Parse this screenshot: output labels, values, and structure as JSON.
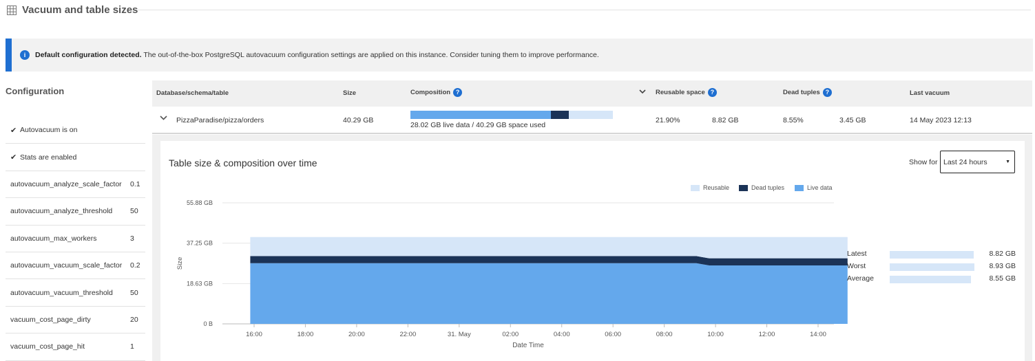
{
  "section": {
    "title": "Vacuum and table sizes",
    "icon": "table-grid-icon"
  },
  "banner": {
    "icon": "info-icon",
    "icon_glyph": "i",
    "bold": "Default configuration detected.",
    "text": " The out-of-the-box PostgreSQL autovacuum configuration settings are applied on this instance. Consider tuning them to improve performance.",
    "accent_color": "#1f6fd1"
  },
  "config": {
    "heading": "Configuration",
    "checks": [
      {
        "label": "Autovacuum is on"
      },
      {
        "label": "Stats are enabled"
      }
    ],
    "settings": [
      {
        "name": "autovacuum_analyze_scale_factor",
        "value": "0.1"
      },
      {
        "name": "autovacuum_analyze_threshold",
        "value": "50"
      },
      {
        "name": "autovacuum_max_workers",
        "value": "3"
      },
      {
        "name": "autovacuum_vacuum_scale_factor",
        "value": "0.2"
      },
      {
        "name": "autovacuum_vacuum_threshold",
        "value": "50"
      },
      {
        "name": "vacuum_cost_page_dirty",
        "value": "20"
      },
      {
        "name": "vacuum_cost_page_hit",
        "value": "1"
      }
    ]
  },
  "table": {
    "headers": {
      "name": "Database/schema/table",
      "size": "Size",
      "composition": "Composition",
      "reusable": "Reusable space",
      "dead": "Dead tuples",
      "last_vacuum": "Last vacuum"
    },
    "row": {
      "name": "PizzaParadise/pizza/orders",
      "size": "40.29 GB",
      "live_fraction": 0.695,
      "dead_fraction": 0.086,
      "composition_label": "28.02 GB live data / 40.29 GB space used",
      "reusable_pct": "21.90%",
      "reusable_size": "8.82 GB",
      "dead_pct": "8.55%",
      "dead_size": "3.45 GB",
      "last_vacuum": "14 May 2023 12:13"
    }
  },
  "chart_panel": {
    "title": "Table size & composition over time",
    "show_for_label": "Show for",
    "range_value": "Last 24 hours"
  },
  "chart_data": {
    "type": "area",
    "stacked": true,
    "title": "Table size & composition over time",
    "xlabel": "Date Time",
    "ylabel": "Size",
    "y_ticks": [
      "0 B",
      "18.63 GB",
      "37.25 GB",
      "55.88 GB"
    ],
    "y_tick_values": [
      0,
      18.63,
      37.25,
      55.88
    ],
    "ylim": [
      0,
      55.88
    ],
    "x_ticks": [
      "16:00",
      "18:00",
      "20:00",
      "22:00",
      "31. May",
      "02:00",
      "04:00",
      "06:00",
      "08:00",
      "10:00",
      "12:00",
      "14:00"
    ],
    "x_tick_hours": [
      16,
      18,
      20,
      22,
      24,
      26,
      28,
      30,
      32,
      34,
      36,
      38
    ],
    "x": [
      15.85,
      18,
      20,
      22,
      24,
      26,
      28,
      30,
      32,
      33.25,
      33.75,
      36,
      39.15
    ],
    "legend_placement": "top-right",
    "series": [
      {
        "name": "Live data",
        "color": "#64a8ec",
        "values": [
          28.0,
          28.0,
          28.0,
          28.0,
          28.0,
          28.0,
          28.0,
          28.0,
          28.0,
          28.0,
          27.0,
          27.0,
          27.0
        ]
      },
      {
        "name": "Dead tuples",
        "color": "#1b3357",
        "values": [
          3.3,
          3.3,
          3.3,
          3.3,
          3.3,
          3.3,
          3.3,
          3.3,
          3.3,
          3.3,
          3.3,
          3.3,
          3.3
        ]
      },
      {
        "name": "Reusable",
        "color": "#d6e6f8",
        "values": [
          8.8,
          8.8,
          8.8,
          8.8,
          8.8,
          8.8,
          8.8,
          8.8,
          8.8,
          8.8,
          9.8,
          9.8,
          9.8
        ]
      }
    ],
    "legend_order": [
      "Reusable",
      "Dead tuples",
      "Live data"
    ]
  },
  "reusable_stats": [
    {
      "label": "Latest",
      "value": "8.82 GB",
      "gb": 8.82
    },
    {
      "label": "Worst",
      "value": "8.93 GB",
      "gb": 8.93
    },
    {
      "label": "Average",
      "value": "8.55 GB",
      "gb": 8.55
    }
  ]
}
